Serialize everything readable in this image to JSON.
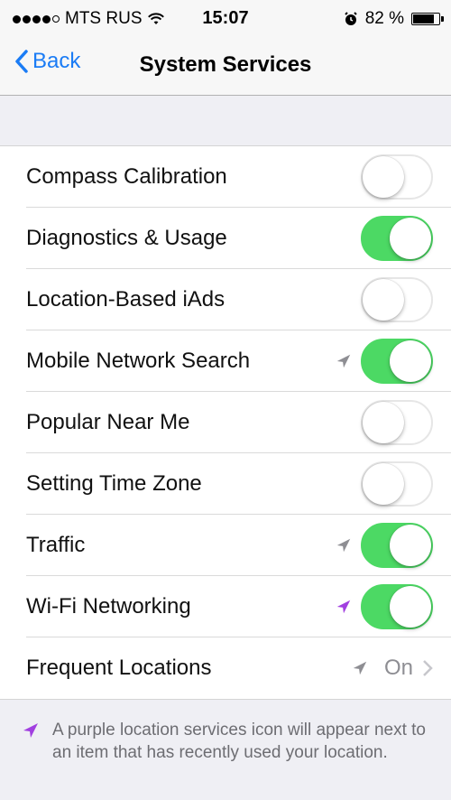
{
  "status_bar": {
    "carrier": "MTS RUS",
    "time": "15:07",
    "battery_percent_text": "82 %",
    "battery_level": 0.82,
    "signal_bars_filled": 4,
    "signal_bars_total": 5
  },
  "nav": {
    "back_label": "Back",
    "title": "System Services"
  },
  "rows": [
    {
      "label": "Compass Calibration",
      "type": "toggle",
      "on": false,
      "location_icon": null
    },
    {
      "label": "Diagnostics & Usage",
      "type": "toggle",
      "on": true,
      "location_icon": null
    },
    {
      "label": "Location-Based iAds",
      "type": "toggle",
      "on": false,
      "location_icon": null
    },
    {
      "label": "Mobile Network Search",
      "type": "toggle",
      "on": true,
      "location_icon": "gray"
    },
    {
      "label": "Popular Near Me",
      "type": "toggle",
      "on": false,
      "location_icon": null
    },
    {
      "label": "Setting Time Zone",
      "type": "toggle",
      "on": false,
      "location_icon": null
    },
    {
      "label": "Traffic",
      "type": "toggle",
      "on": true,
      "location_icon": "gray"
    },
    {
      "label": "Wi-Fi Networking",
      "type": "toggle",
      "on": true,
      "location_icon": "purple"
    },
    {
      "label": "Frequent Locations",
      "type": "detail",
      "value": "On",
      "location_icon": "gray"
    }
  ],
  "footer": {
    "text": "A purple location services icon will appear next to an item that has recently used your location."
  },
  "colors": {
    "accent_blue": "#1b7cf5",
    "toggle_on": "#4cd964",
    "location_gray": "#8e8e93",
    "location_purple": "#a13fe0",
    "background": "#efeff4"
  }
}
